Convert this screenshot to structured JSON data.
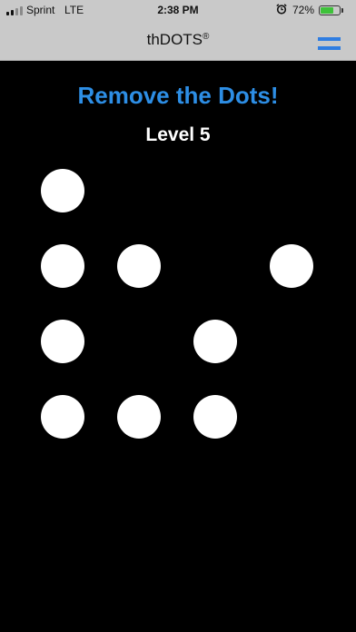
{
  "status_bar": {
    "carrier": "Sprint",
    "network": "LTE",
    "time": "2:38 PM",
    "battery_percent": "72%",
    "battery_level": 0.72,
    "signal_bars_filled": 2,
    "signal_bars_total": 4,
    "alarm_icon": "alarm-clock-icon",
    "battery_color": "#3ec23a"
  },
  "nav": {
    "title": "thDOTS",
    "title_mark": "®",
    "menu_icon": "hamburger-menu-icon",
    "accent_color": "#2f7de1"
  },
  "game": {
    "heading": "Remove the Dots!",
    "heading_color": "#2d8ee5",
    "level_label": "Level 5",
    "grid_columns": 4,
    "grid_rows": 4,
    "dots": [
      {
        "row": 0,
        "col": 0
      },
      {
        "row": 1,
        "col": 0
      },
      {
        "row": 1,
        "col": 1
      },
      {
        "row": 1,
        "col": 3
      },
      {
        "row": 2,
        "col": 0
      },
      {
        "row": 2,
        "col": 2
      },
      {
        "row": 3,
        "col": 0
      },
      {
        "row": 3,
        "col": 1
      },
      {
        "row": 3,
        "col": 2
      }
    ]
  }
}
